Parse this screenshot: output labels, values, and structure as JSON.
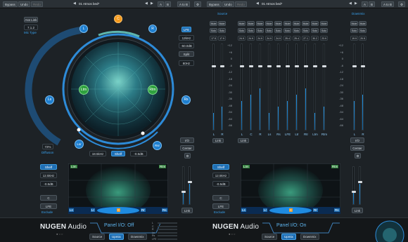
{
  "topbar": {
    "bypass": "Bypass",
    "undo": "Undo",
    "redo": "Redo",
    "preset_arrow": "◀",
    "preset_name_left": "01 Atmos bed*",
    "preset_name_right": "01 Atmos bed*",
    "ab_a": "A",
    "ab_b": "B",
    "ab_copy": "A to B",
    "nav_left": "◀",
    "nav_right": "▶",
    "gear": "⚙"
  },
  "left": {
    "mic_ctrl_top": "Ass Link",
    "mic_value": "7.1.2",
    "mic_type": "Mic Type",
    "speakers": {
      "L": "L",
      "C": "C",
      "R": "R",
      "Ls": "Ls",
      "Rs": "Rs",
      "Ltm": "Ltm",
      "Rtm": "Rtm",
      "Lsr": "Lsr",
      "Rsr": "Rsr"
    },
    "lfe_btn": "LFE",
    "lfe_hz": "12kHz",
    "lfe_db": "-50.0dB",
    "split": "Split",
    "split_hz": "80Hz",
    "diffusion_val": "72%",
    "diffusion": "Diffusion",
    "freq": "18.5kHz",
    "shelf": "Shelf",
    "gain": "-0.5dB",
    "io": "I/O",
    "center": "Center",
    "reset": "⚙",
    "shelf_btn": "Shelf",
    "shelf_hz": "12.5kHz",
    "shelf_db": "-0.5dB",
    "c_btn": "C",
    "lfe2": "LFE",
    "exclude": "Exclude",
    "spec_top_l": "Ltm",
    "spec_top_r": "Rtm",
    "spec_bot": [
      "Ls",
      "Lr",
      "C",
      "Rr",
      "Rs"
    ],
    "link": "Link",
    "brand_bold": "NUGEN",
    "brand_light": " Audio",
    "panel_title": "Panel I/O: Off",
    "tabs": [
      "Source",
      "Upmix",
      "Downmix"
    ],
    "active_tab": "Upmix"
  },
  "right": {
    "source": "Source",
    "downmix": "Downmix",
    "mute": "Mute",
    "solo": "Solo",
    "ch_names": [
      "L",
      "C",
      "R",
      "Ls",
      "Rs",
      "LFE",
      "Ltr",
      "Rtr",
      "Ltm",
      "Rtm"
    ],
    "ch_vals": [
      "24.9",
      "24.9",
      "24.9",
      "24.9",
      "24.9",
      "25.4",
      "25.4",
      "27.1",
      "30.2",
      "23.9"
    ],
    "src_vals": [
      "17.5",
      "17.9"
    ],
    "dm_vals": [
      "19.9",
      "20.5"
    ],
    "scale": [
      "+12",
      "+6",
      "0",
      "-6",
      "-12",
      "-18",
      "-24",
      "-30",
      "-36",
      "-48",
      "-54",
      "-64",
      "-66"
    ],
    "src_lr": [
      "L",
      "R"
    ],
    "dm_lr": [
      "L",
      "R"
    ],
    "link": "Link",
    "io": "I/O",
    "center": "Center",
    "reset": "⚙",
    "shelf_btn": "Shelf",
    "shelf_hz": "12.5kHz",
    "shelf_db": "-0.5dB",
    "c_btn": "C",
    "lfe2": "LFE",
    "exclude": "Exclude",
    "spec_top_l": "Ltm",
    "spec_top_r": "Rtm",
    "spec_bot": [
      "Ls",
      "Lr",
      "C",
      "Rr",
      "Rs"
    ],
    "brand_bold": "NUGEN",
    "brand_light": " Audio",
    "panel_title": "Panel I/O: On",
    "tabs": [
      "Source",
      "Upmix",
      "Downmix"
    ],
    "active_tab": "Upmix",
    "mini_labels": [
      "L",
      "C",
      "R",
      "Ls",
      "Rs",
      "LFE"
    ]
  },
  "colors": {
    "accent": "#1f8be0",
    "center_spk": "#f59a1d",
    "mic_green": "#3bb24a",
    "bg": "#1d2226"
  }
}
